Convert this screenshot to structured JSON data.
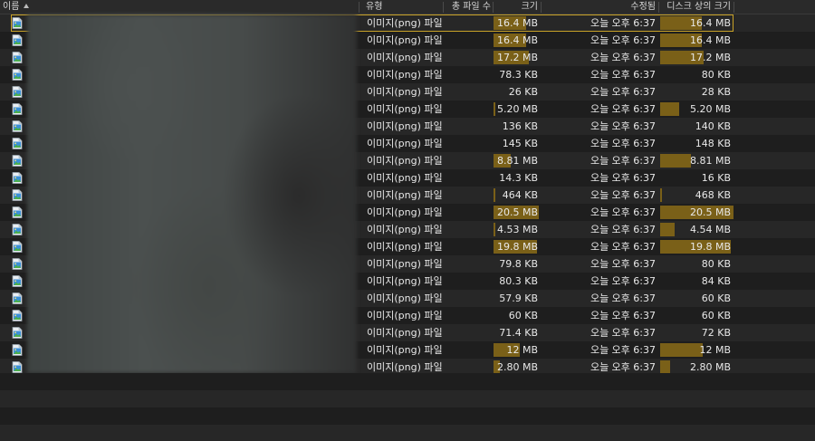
{
  "columns": {
    "name": "이름",
    "kind": "유형",
    "total_files": "총 파일 수",
    "size": "크기",
    "modified": "수정됨",
    "disk_size": "디스크 상의 크기"
  },
  "colors": {
    "bar": "#7a6018",
    "selection": "#c9a227",
    "header": "#2a2a2a"
  },
  "icons": {
    "file": "png-image-file-icon",
    "sort": "sort-ascending-icon"
  },
  "rows": [
    {
      "kind": "이미지(png) 파일",
      "size": "16.4 MB",
      "size_frac": 0.33,
      "day": "오늘",
      "time": "오후 6:37",
      "disk": "16.4 MB",
      "disk_frac": 0.56
    },
    {
      "kind": "이미지(png) 파일",
      "size": "16.4 MB",
      "size_frac": 0.33,
      "day": "오늘",
      "time": "오후 6:37",
      "disk": "16.4 MB",
      "disk_frac": 0.56
    },
    {
      "kind": "이미지(png) 파일",
      "size": "17.2 MB",
      "size_frac": 0.35,
      "day": "오늘",
      "time": "오후 6:37",
      "disk": "17.2 MB",
      "disk_frac": 0.59
    },
    {
      "kind": "이미지(png) 파일",
      "size": "78.3 KB",
      "size_frac": 0,
      "day": "오늘",
      "time": "오후 6:37",
      "disk": "80 KB",
      "disk_frac": 0
    },
    {
      "kind": "이미지(png) 파일",
      "size": "26 KB",
      "size_frac": 0,
      "day": "오늘",
      "time": "오후 6:37",
      "disk": "28 KB",
      "disk_frac": 0
    },
    {
      "kind": "이미지(png) 파일",
      "size": "5.20 MB",
      "size_frac": 0.02,
      "day": "오늘",
      "time": "오후 6:37",
      "disk": "5.20 MB",
      "disk_frac": 0.25
    },
    {
      "kind": "이미지(png) 파일",
      "size": "136 KB",
      "size_frac": 0,
      "day": "오늘",
      "time": "오후 6:37",
      "disk": "140 KB",
      "disk_frac": 0
    },
    {
      "kind": "이미지(png) 파일",
      "size": "145 KB",
      "size_frac": 0,
      "day": "오늘",
      "time": "오후 6:37",
      "disk": "148 KB",
      "disk_frac": 0
    },
    {
      "kind": "이미지(png) 파일",
      "size": "8.81 MB",
      "size_frac": 0.17,
      "day": "오늘",
      "time": "오후 6:37",
      "disk": "8.81 MB",
      "disk_frac": 0.41
    },
    {
      "kind": "이미지(png) 파일",
      "size": "14.3 KB",
      "size_frac": 0,
      "day": "오늘",
      "time": "오후 6:37",
      "disk": "16 KB",
      "disk_frac": 0
    },
    {
      "kind": "이미지(png) 파일",
      "size": "464 KB",
      "size_frac": 0.01,
      "day": "오늘",
      "time": "오후 6:37",
      "disk": "468 KB",
      "disk_frac": 0.01
    },
    {
      "kind": "이미지(png) 파일",
      "size": "20.5 MB",
      "size_frac": 0.46,
      "day": "오늘",
      "time": "오후 6:37",
      "disk": "20.5 MB",
      "disk_frac": 0.99
    },
    {
      "kind": "이미지(png) 파일",
      "size": "4.53 MB",
      "size_frac": 0.02,
      "day": "오늘",
      "time": "오후 6:37",
      "disk": "4.54 MB",
      "disk_frac": 0.2
    },
    {
      "kind": "이미지(png) 파일",
      "size": "19.8 MB",
      "size_frac": 0.44,
      "day": "오늘",
      "time": "오후 6:37",
      "disk": "19.8 MB",
      "disk_frac": 0.95
    },
    {
      "kind": "이미지(png) 파일",
      "size": "79.8 KB",
      "size_frac": 0,
      "day": "오늘",
      "time": "오후 6:37",
      "disk": "80 KB",
      "disk_frac": 0
    },
    {
      "kind": "이미지(png) 파일",
      "size": "80.3 KB",
      "size_frac": 0,
      "day": "오늘",
      "time": "오후 6:37",
      "disk": "84 KB",
      "disk_frac": 0
    },
    {
      "kind": "이미지(png) 파일",
      "size": "57.9 KB",
      "size_frac": 0,
      "day": "오늘",
      "time": "오후 6:37",
      "disk": "60 KB",
      "disk_frac": 0
    },
    {
      "kind": "이미지(png) 파일",
      "size": "60 KB",
      "size_frac": 0,
      "day": "오늘",
      "time": "오후 6:37",
      "disk": "60 KB",
      "disk_frac": 0
    },
    {
      "kind": "이미지(png) 파일",
      "size": "71.4 KB",
      "size_frac": 0,
      "day": "오늘",
      "time": "오후 6:37",
      "disk": "72 KB",
      "disk_frac": 0
    },
    {
      "kind": "이미지(png) 파일",
      "size": "12 MB",
      "size_frac": 0.26,
      "day": "오늘",
      "time": "오후 6:37",
      "disk": "12 MB",
      "disk_frac": 0.57
    },
    {
      "kind": "이미지(png) 파일",
      "size": "2.80 MB",
      "size_frac": 0.06,
      "day": "오늘",
      "time": "오후 6:37",
      "disk": "2.80 MB",
      "disk_frac": 0.13
    }
  ]
}
